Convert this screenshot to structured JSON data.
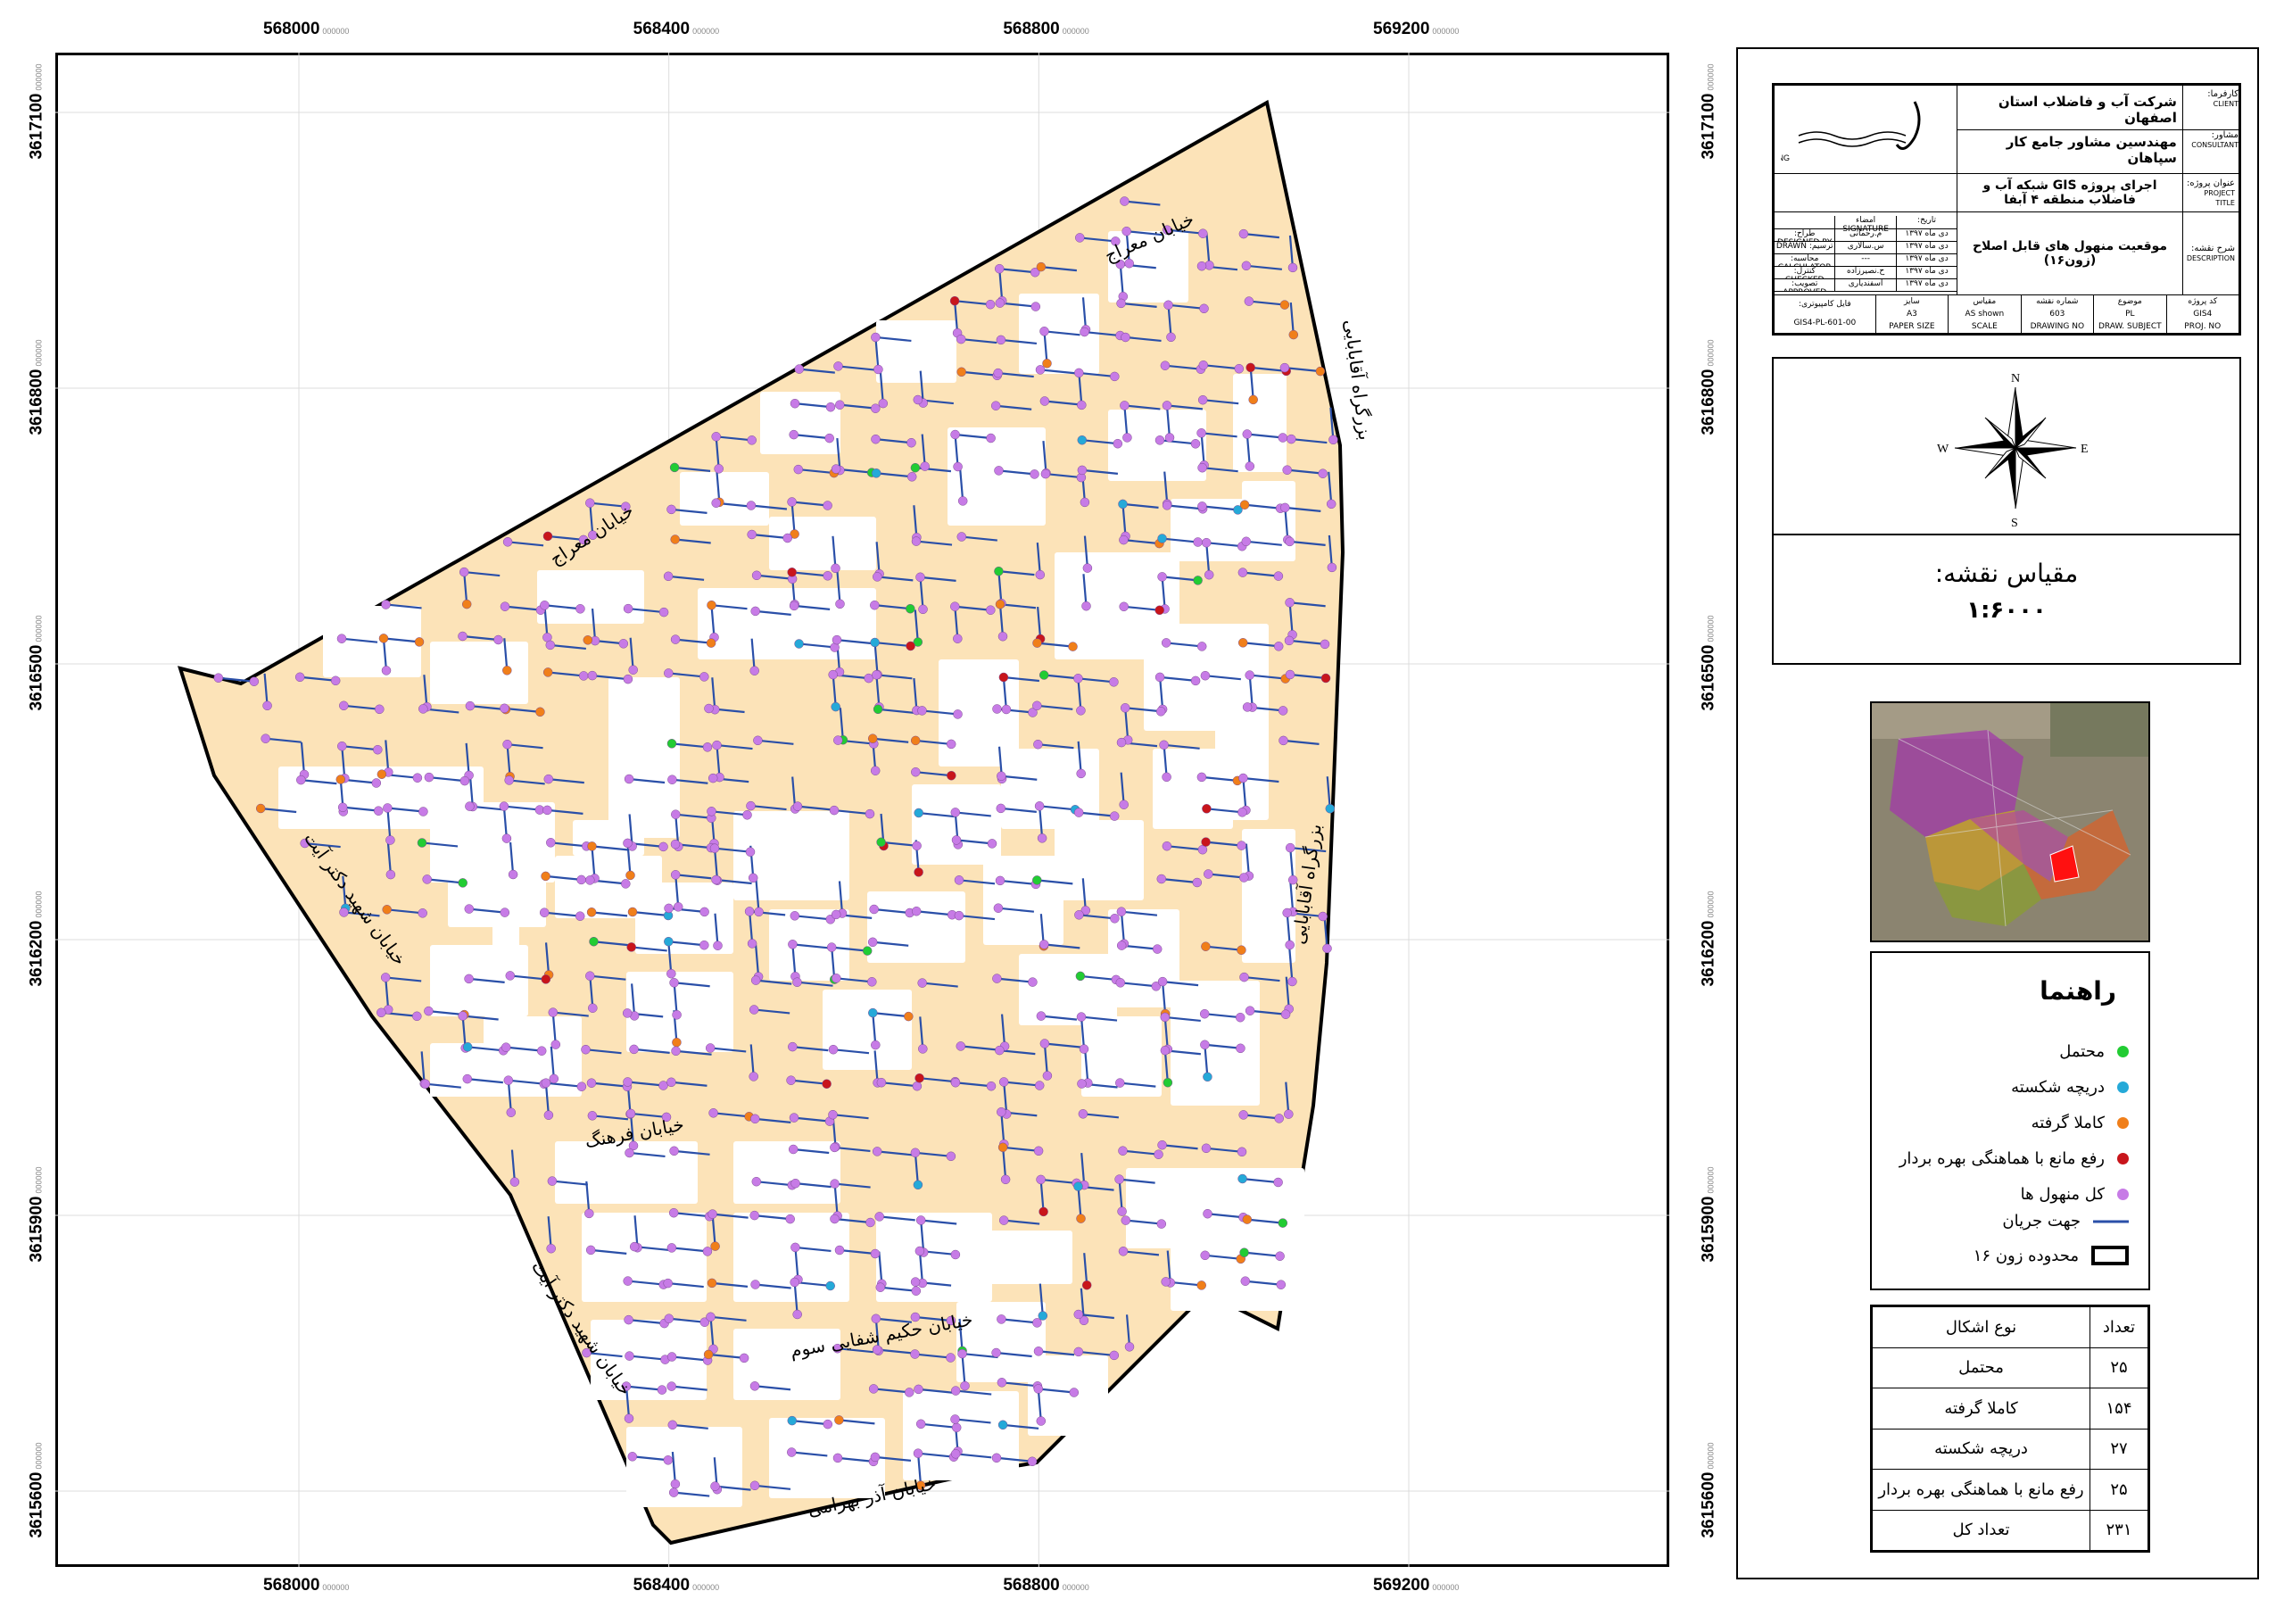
{
  "map": {
    "x_ticks": [
      "568000",
      "568400",
      "568800",
      "569200"
    ],
    "y_ticks": [
      "3617100",
      "3616800",
      "3616500",
      "3616200",
      "3615900",
      "3615600"
    ],
    "tick_suffix": "000000",
    "streets": {
      "meraj_1": "خیابان معراج",
      "meraj_2": "خیابان معراج",
      "aghababaei_1": "بزرگراه آقابابایی",
      "aghababaei_2": "بزرگراه آقابابایی",
      "dr_beheshti_1": "خیابان شهید دکتر آیت",
      "dr_beheshti_2": "خیابان شهید دکتر آیت",
      "farhang": "خیابان فرهنگ",
      "hakim": "خیابان حکیم شفایی سوم",
      "azar": "خیابان آذر بهرامی"
    },
    "colors": {
      "zone_fill": "#fce3b8",
      "block_fill": "#ffffff",
      "pipe": "#2a4fa8",
      "manhole": "#c77be6",
      "green": "#22cc33",
      "cyan": "#25a9d8",
      "orange": "#f07f1a",
      "red": "#c8151b"
    }
  },
  "title_block": {
    "client_label": "کارفرما:",
    "client_en": "CLIENT",
    "client_value": "شرکت آب و فاضلاب استان اصفهان",
    "consultant_label": "مشاور:",
    "consultant_en": "CONSULTANT",
    "consultant_value": "مهندسین مشاور جامع کار سپاهان",
    "project_label": "عنوان پروژه:",
    "project_en": "PROJECT TITLE",
    "project_value": "اجرای پروژه GIS شبکه آب و فاضلاب منطقه ۴ آبفا",
    "description_label": "شرح نقشه:",
    "description_en": "DESCRIPTION",
    "description_value": "موقعیت منهول های قابل اصلاح (زون۱۶)",
    "logo_text": "مهندسین مشاور جامع کار سپاهان",
    "logo_en": "J.K.S CONS. ENG.",
    "date_label": "تاریخ:",
    "signature_label": "امضاء SIGNATURE",
    "rows": [
      {
        "date": "دی ماه ۱۳۹۷",
        "name": "م.رحمانی",
        "role": "طراح: DESIGNED BY"
      },
      {
        "date": "دی ماه ۱۳۹۷",
        "name": "س.سالاری",
        "role": "ترسیم: DRAWN"
      },
      {
        "date": "دی ماه ۱۳۹۷",
        "name": "---",
        "role": "محاسبه: CALCULATOR"
      },
      {
        "date": "دی ماه ۱۳۹۷",
        "name": "ح.نصیرزاده",
        "role": "کنترل: CHECKED"
      },
      {
        "date": "دی ماه ۱۳۹۷",
        "name": "اسفندیاری",
        "role": "تصویب: APPROVED"
      }
    ],
    "meta_headers": [
      "کد پروژه",
      "موضوع",
      "شماره نقشه",
      "مقیاس",
      "سایز"
    ],
    "meta_values": [
      "GIS4",
      "PL",
      "603",
      "AS shown",
      "A3"
    ],
    "meta_en": [
      "PROJ. NO",
      "DRAW. SUBJECT",
      "DRAWING NO",
      "SCALE",
      "PAPER SIZE"
    ],
    "file_label": "فایل کامپیوتری:",
    "file_value": "GIS4-PL-601-00"
  },
  "compass": {
    "n": "N",
    "s": "S",
    "e": "E",
    "w": "W"
  },
  "scale": {
    "label": "مقیاس نقشه:",
    "value": "۱:۶۰۰۰"
  },
  "legend": {
    "title": "راهنما",
    "items": [
      {
        "label": "محتمل",
        "color": "#22cc33"
      },
      {
        "label": "دریچه شکسته",
        "color": "#25a9d8"
      },
      {
        "label": "کاملا گرفته",
        "color": "#f07f1a"
      },
      {
        "label": "رفع مانع با هماهنگی بهره بردار",
        "color": "#c8151b"
      },
      {
        "label": "کل منهول ها",
        "color": "#c77be6"
      }
    ],
    "flow_label": "جهت جریان",
    "zone_label": "محدوده زون ۱۶"
  },
  "stats": {
    "header_type": "نوع اشکال",
    "header_count": "تعداد",
    "rows": [
      {
        "type": "محتمل",
        "count": "۲۵"
      },
      {
        "type": "کاملا گرفته",
        "count": "۱۵۴"
      },
      {
        "type": "دریچه شکسته",
        "count": "۲۷"
      },
      {
        "type": "رفع مانع با هماهنگی بهره بردار",
        "count": "۲۵"
      },
      {
        "type": "تعداد کل",
        "count": "۲۳۱"
      }
    ]
  }
}
